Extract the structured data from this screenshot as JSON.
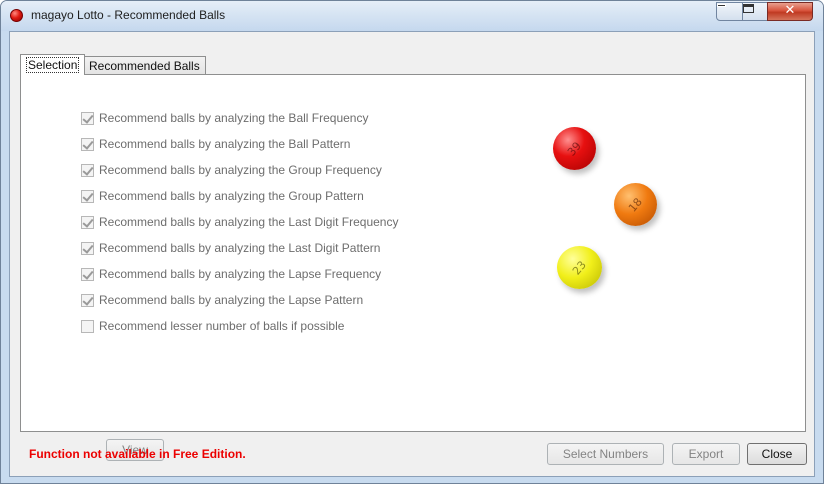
{
  "window": {
    "title": "magayo Lotto - Recommended Balls",
    "controls": {
      "minimize": "minimize",
      "maximize": "maximize",
      "close": "✕"
    }
  },
  "tabs": [
    {
      "label": "Selection",
      "selected": true
    },
    {
      "label": "Recommended Balls",
      "selected": false
    }
  ],
  "options": [
    {
      "label": "Recommend balls by analyzing the Ball Frequency",
      "checked": true
    },
    {
      "label": "Recommend balls by analyzing the Ball Pattern",
      "checked": true
    },
    {
      "label": "Recommend balls by analyzing the Group Frequency",
      "checked": true
    },
    {
      "label": "Recommend balls by analyzing the Group Pattern",
      "checked": true
    },
    {
      "label": "Recommend balls by analyzing the Last Digit Frequency",
      "checked": true
    },
    {
      "label": "Recommend balls by analyzing the Last Digit Pattern",
      "checked": true
    },
    {
      "label": "Recommend balls by analyzing the Lapse Frequency",
      "checked": true
    },
    {
      "label": "Recommend balls by analyzing the Lapse Pattern",
      "checked": true
    },
    {
      "label": "Recommend lesser number of balls if possible",
      "checked": false
    }
  ],
  "balls": [
    {
      "number": "39",
      "color": "#e71010"
    },
    {
      "number": "18",
      "color": "#f07a10"
    },
    {
      "number": "23",
      "color": "#f1ef1a"
    }
  ],
  "buttons": {
    "view": "View",
    "select_numbers": "Select Numbers",
    "export": "Export",
    "close": "Close"
  },
  "status": {
    "message": "Function not available in Free Edition.",
    "color": "#ec0000"
  }
}
